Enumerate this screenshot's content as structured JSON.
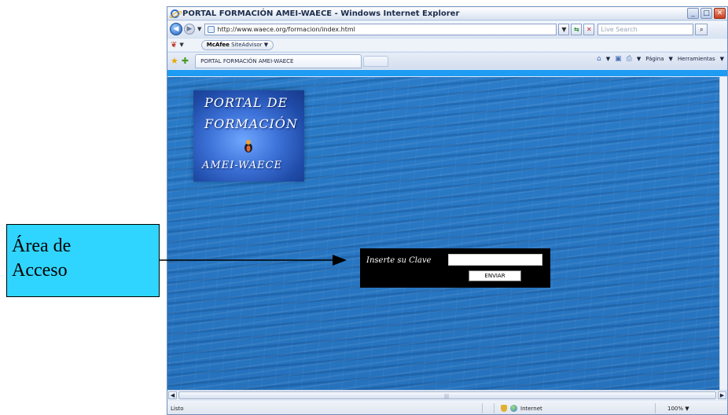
{
  "window": {
    "title": "PORTAL FORMACIÓN AMEI-WAECE - Windows Internet Explorer",
    "min_label": "_",
    "max_label": "□",
    "close_label": "✕"
  },
  "nav": {
    "back_icon": "◀",
    "forward_icon": "▶",
    "history_dropdown": "▼",
    "address": "http://www.waece.org/formacion/index.html",
    "address_dropdown": "▼",
    "refresh_icon": "⇆",
    "stop_icon": "✕",
    "search_placeholder": "Live Search",
    "search_icon": "⌕"
  },
  "addons": {
    "home_icon": "❦",
    "home_dropdown": "▼",
    "mcafee_brand": "McAfee",
    "mcafee_product": "SiteAdvisor",
    "mcafee_dropdown": "▼"
  },
  "tabs": {
    "favorites_icon": "★",
    "add_favorites_icon": "✚",
    "active_tab": "PORTAL FORMACIÓN AMEI-WAECE",
    "commands": {
      "home_icon": "⌂",
      "feeds_icon": "▣",
      "print_icon": "⎙",
      "page_label": "Página",
      "tools_label": "Herramientas",
      "dropdown": "▼"
    }
  },
  "page": {
    "logo": {
      "line1": "PORTAL DE",
      "line2": "FORMACIÓN",
      "line3": "AMEI-WAECE"
    },
    "login": {
      "label": "Inserte su Clave",
      "key_value": "",
      "submit_label": "ENVIAR"
    }
  },
  "scrollbar": {
    "left_arrow": "◀",
    "right_arrow": "▶",
    "grip": "|||"
  },
  "status": {
    "text": "Listo",
    "zone": "Internet",
    "zoom": "100%",
    "zoom_dropdown": "▼"
  },
  "callout": {
    "line1": "Área de",
    "line2": "Acceso"
  },
  "colors": {
    "page_background": "#2672bd",
    "top_strip": "#1e9bf2",
    "login_box": "#000000",
    "callout_fill": "#2fd5ff"
  }
}
